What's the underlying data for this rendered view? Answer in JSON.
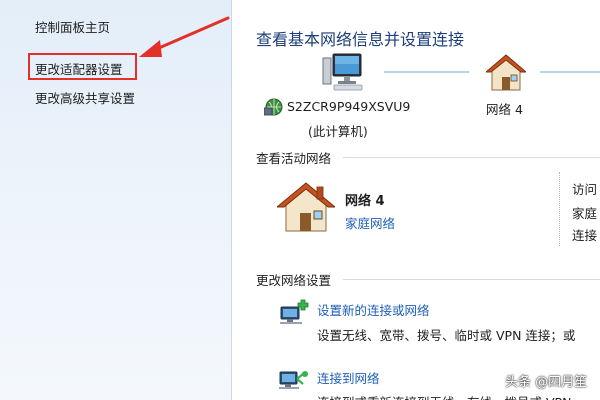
{
  "sidebar": {
    "home_label": "控制面板主页",
    "adapter_label": "更改适配器设置",
    "share_label": "更改高级共享设置"
  },
  "main": {
    "title": "查看基本网络信息并设置连接",
    "computer_name": "S2ZCR9P949XSVU9",
    "computer_sub": "(此计算机)",
    "network_top_label": "网络  4"
  },
  "active": {
    "heading": "查看活动网络",
    "network_name": "网络  4",
    "network_type": "家庭网络",
    "right_labels": [
      "访问",
      "家庭",
      "连接"
    ]
  },
  "change": {
    "heading": "更改网络设置",
    "tasks": [
      {
        "link": "设置新的连接或网络",
        "desc": "设置无线、宽带、拨号、临时或 VPN 连接；或"
      },
      {
        "link": "连接到网络",
        "desc": "连接到或重新连接到无线、有线、拨号或 VPN"
      }
    ]
  },
  "watermark": "头条 @四月笙",
  "colors": {
    "highlight_red": "#e3312a",
    "link_blue": "#1f5fb8",
    "title_blue": "#1e3f78"
  },
  "icons": [
    "computer-icon",
    "house-icon",
    "network-icon",
    "new-connection-icon",
    "connect-network-icon"
  ]
}
